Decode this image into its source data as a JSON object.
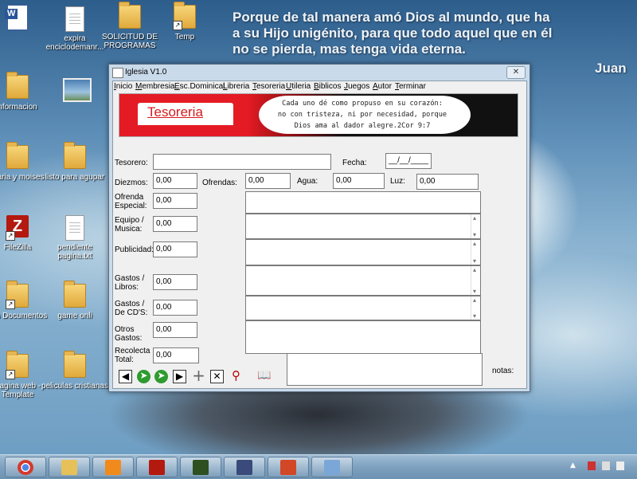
{
  "desktop": {
    "verse_lines": [
      "Porque de tal manera amó Dios al mundo,  que ha",
      "a su Hijo unigénito,  para que todo aquel que en él",
      "no se pierda, mas tenga vida eterna."
    ],
    "verse_ref": "Juan",
    "icons": [
      {
        "label": "",
        "type": "word"
      },
      {
        "label": "expira enciclodemanr...",
        "type": "doc"
      },
      {
        "label": "SOLICITUD DE PROGRAMAS",
        "type": "folder"
      },
      {
        "label": "Temp",
        "type": "folder"
      },
      {
        "label": "nformacion",
        "type": "folder"
      },
      {
        "label": "",
        "type": "picture"
      },
      {
        "label": "maria y moises",
        "type": "folder"
      },
      {
        "label": "listo para agupar",
        "type": "folder"
      },
      {
        "label": "FileZilla",
        "type": "filezilla"
      },
      {
        "label": "pendiente pagina.txt",
        "type": "doc"
      },
      {
        "label": "Mis Documentos",
        "type": "folder"
      },
      {
        "label": "game onli",
        "type": "folder"
      },
      {
        "label": "Pagina web - Template",
        "type": "folder"
      },
      {
        "label": "peliculas cristianas",
        "type": "folder"
      }
    ]
  },
  "window": {
    "title": "Iglesia V1.0",
    "close_label": "✕",
    "menu": [
      "Inicio",
      "Membresia",
      "Esc.Dominical",
      "Libreria",
      "Tesoreria",
      "Utileria",
      "Biblicos",
      "Juegos",
      "Autor",
      "Terminar"
    ],
    "banner": {
      "title": "Tesoreria",
      "quote_lines": [
        "Cada uno dé como propuso en su corazón:",
        "no con tristeza,  ni por necesidad,  porque",
        "Dios ama al dador alegre.2Cor 9:7"
      ]
    },
    "form": {
      "tesorero_label": "Tesorero:",
      "tesorero_value": "",
      "fecha_label": "Fecha:",
      "fecha_value": "__/__/____",
      "diezmos_label": "Diezmos:",
      "diezmos_value": "0,00",
      "ofrendas_label": "Ofrendas:",
      "ofrendas_value": "0,00",
      "agua_label": "Agua:",
      "agua_value": "0,00",
      "luz_label": "Luz:",
      "luz_value": "0,00",
      "ofrenda_especial_label": [
        "Ofrenda",
        "Especial:"
      ],
      "ofrenda_especial_value": "0,00",
      "equipo_label": [
        "Equipo /",
        "Musica:"
      ],
      "equipo_value": "0,00",
      "publicidad_label": "Publicidad:",
      "publicidad_value": "0,00",
      "gastos_libros_label": [
        "Gastos /",
        "Libros:"
      ],
      "gastos_libros_value": "0,00",
      "gastos_cds_label": [
        "Gastos /",
        "De CD'S:"
      ],
      "gastos_cds_value": "0,00",
      "otros_gastos_label": [
        "Otros",
        "Gastos:"
      ],
      "otros_gastos_value": "0,00",
      "recolecta_label": [
        "Recolecta",
        "Total:"
      ],
      "recolecta_value": "0,00",
      "notas_label": "notas:"
    },
    "toolbar": [
      {
        "name": "first-record-button",
        "icon": "first-icon"
      },
      {
        "name": "previous-record-button",
        "icon": "back-circle-icon"
      },
      {
        "name": "next-record-button",
        "icon": "forward-circle-icon"
      },
      {
        "name": "last-record-button",
        "icon": "last-icon"
      },
      {
        "name": "add-record-button",
        "icon": "plus-icon"
      },
      {
        "name": "delete-record-button",
        "icon": "x-icon"
      },
      {
        "name": "search-button",
        "icon": "magnifier-icon"
      },
      {
        "name": "book-button",
        "icon": "book-icon"
      }
    ]
  },
  "taskbar": {
    "apps": [
      "chrome",
      "explorer",
      "media",
      "filezilla",
      "dreamweaver",
      "film",
      "powerpoint",
      "paint"
    ],
    "colors": {
      "chrome": "#d23b2e",
      "explorer": "#e6c15a",
      "media": "#f08a1c",
      "filezilla": "#b3190f",
      "dreamweaver": "#2e4f1f",
      "film": "#3a4a7a",
      "powerpoint": "#d24726",
      "paint": "#7aa6d8"
    }
  }
}
